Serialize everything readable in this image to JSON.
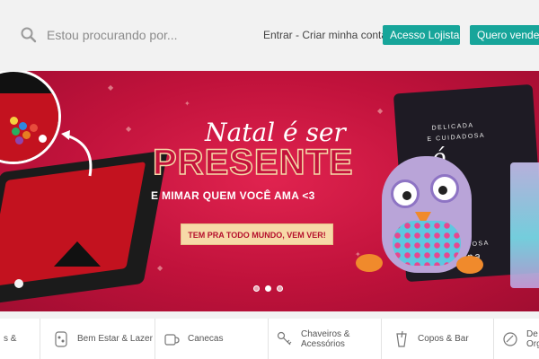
{
  "search": {
    "placeholder": "Estou procurando por..."
  },
  "header": {
    "login_text": "Entrar - Criar minha conta",
    "btn_lojista": "Acesso Lojista",
    "btn_vender": "Quero vender U"
  },
  "colors": {
    "accent": "#17a59a",
    "banner": "#c0123b",
    "cta_bg": "#f7d9a8"
  },
  "banner": {
    "title_script": "Natal é ser",
    "title_big": "PRESENTE",
    "subtitle": "E MIMAR QUEM VOCÊ AMA <3",
    "cta": "TEM PRA TODO MUNDO, VEM VER!",
    "pillow_text_1": "DELICADA",
    "pillow_text_2": "E CUIDADOSA",
    "pillow_script": "ó",
    "pillow_text_3": "CARINHOSA",
    "pillow_text_4": "tina",
    "carousel_dots": 3,
    "carousel_active": 1
  },
  "categories": [
    {
      "label": "s &",
      "icon": "toy-icon"
    },
    {
      "label": "Bem Estar & Lazer",
      "icon": "wellness-icon"
    },
    {
      "label": "Canecas",
      "icon": "mug-icon"
    },
    {
      "label": "Chaveiros &\nAcessórios",
      "icon": "keychain-icon"
    },
    {
      "label": "Copos & Bar",
      "icon": "cup-icon"
    },
    {
      "label": "De\nOrg",
      "icon": "decor-icon"
    }
  ]
}
